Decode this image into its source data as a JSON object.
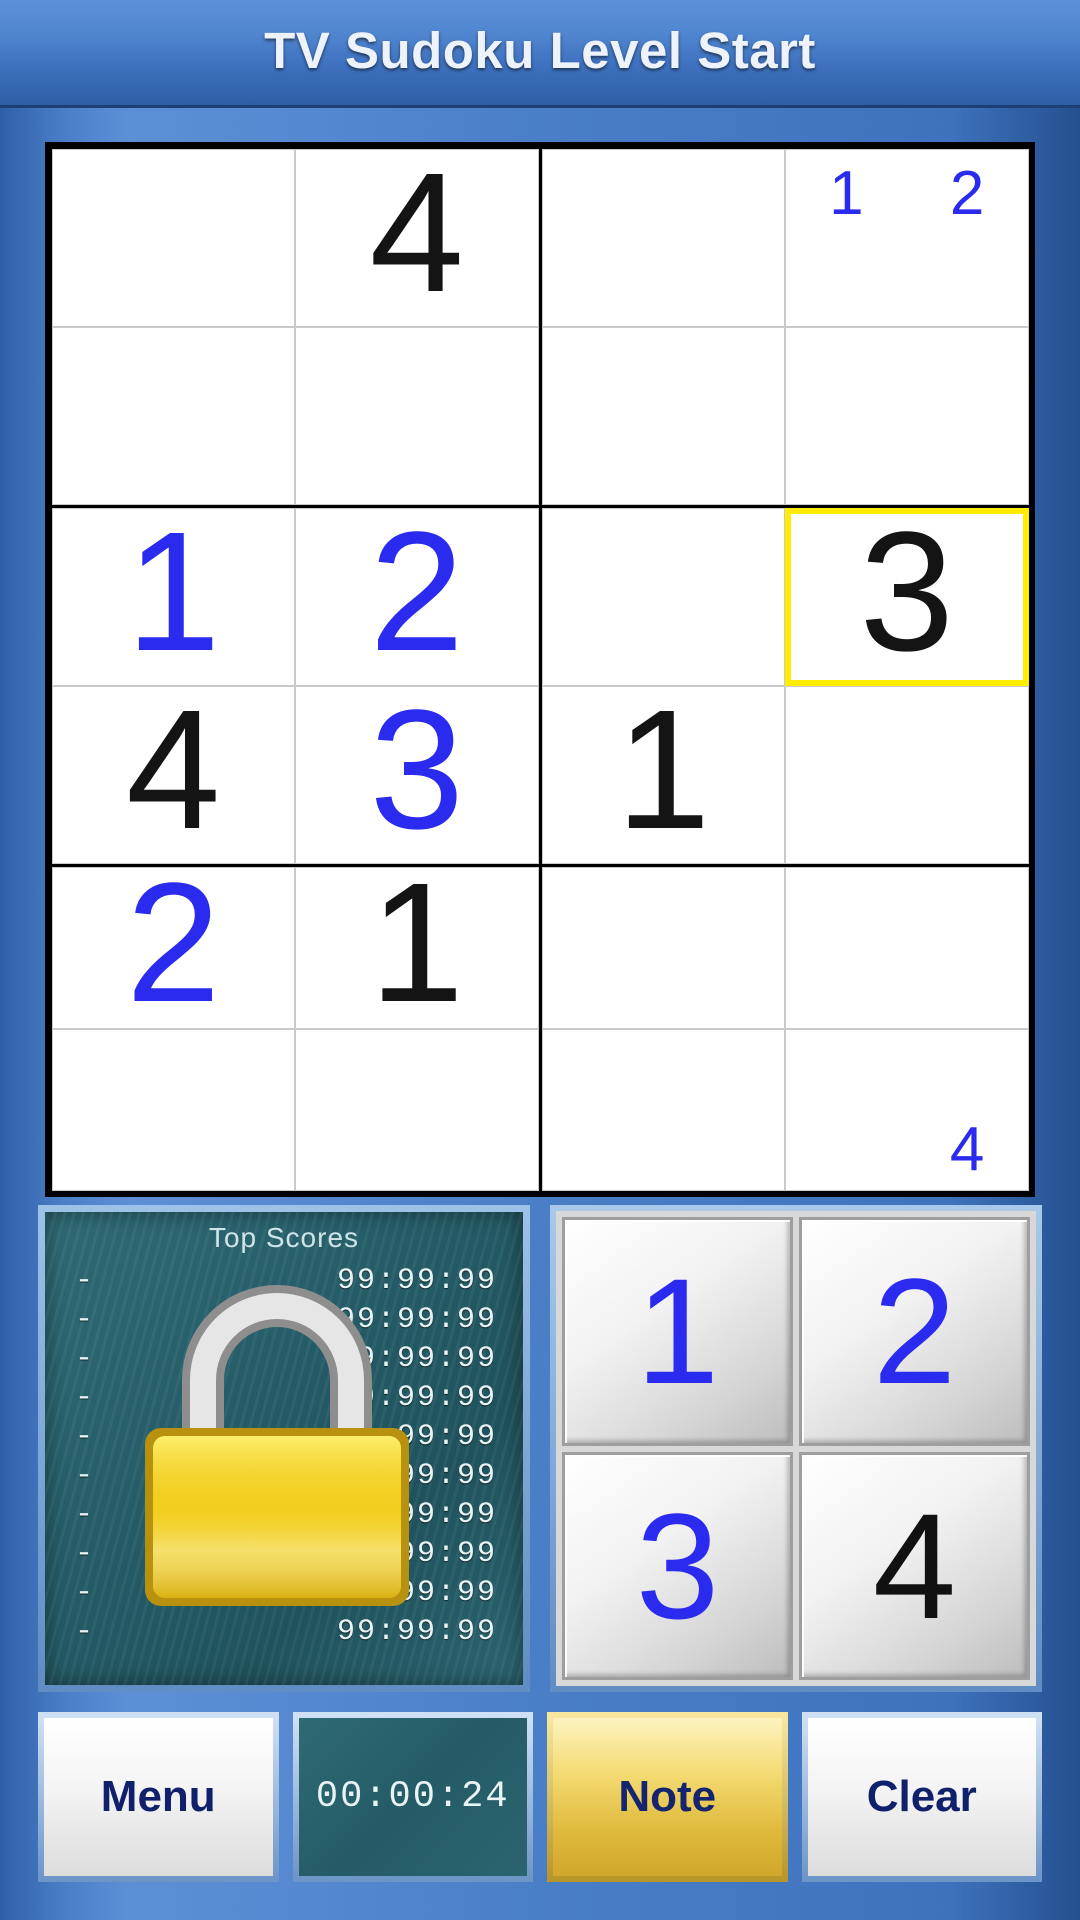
{
  "titlebar": {
    "title": "TV Sudoku Level Start"
  },
  "board": {
    "selected_cell": {
      "block": 3,
      "cell": 1
    },
    "blocks": [
      {
        "cells": [
          {
            "value": "",
            "style": "",
            "notes": []
          },
          {
            "value": "4",
            "style": "given",
            "notes": []
          },
          {
            "value": "",
            "style": "",
            "notes": []
          },
          {
            "value": "",
            "style": "",
            "notes": []
          }
        ]
      },
      {
        "cells": [
          {
            "value": "",
            "style": "",
            "notes": []
          },
          {
            "value": "",
            "style": "",
            "notes": [
              "1",
              "2",
              "",
              ""
            ]
          },
          {
            "value": "",
            "style": "",
            "notes": []
          },
          {
            "value": "",
            "style": "",
            "notes": []
          }
        ]
      },
      {
        "cells": [
          {
            "value": "1",
            "style": "user",
            "notes": []
          },
          {
            "value": "2",
            "style": "user",
            "notes": []
          },
          {
            "value": "4",
            "style": "given",
            "notes": []
          },
          {
            "value": "3",
            "style": "user",
            "notes": []
          }
        ]
      },
      {
        "cells": [
          {
            "value": "",
            "style": "",
            "notes": []
          },
          {
            "value": "3",
            "style": "given",
            "notes": []
          },
          {
            "value": "1",
            "style": "given",
            "notes": []
          },
          {
            "value": "",
            "style": "",
            "notes": []
          }
        ]
      },
      {
        "cells": [
          {
            "value": "2",
            "style": "user",
            "notes": []
          },
          {
            "value": "1",
            "style": "given",
            "notes": []
          },
          {
            "value": "",
            "style": "",
            "notes": []
          },
          {
            "value": "",
            "style": "",
            "notes": []
          }
        ]
      },
      {
        "cells": [
          {
            "value": "",
            "style": "",
            "notes": []
          },
          {
            "value": "",
            "style": "",
            "notes": []
          },
          {
            "value": "",
            "style": "",
            "notes": []
          },
          {
            "value": "",
            "style": "",
            "notes": [
              "",
              "",
              "",
              "4"
            ]
          }
        ]
      }
    ]
  },
  "scores": {
    "title": "Top Scores",
    "locked": true,
    "lock_icon": "padlock-icon",
    "rows": [
      {
        "rank": "-",
        "value": "99:99:99"
      },
      {
        "rank": "-",
        "value": "99:99:99"
      },
      {
        "rank": "-",
        "value": "99:99:99"
      },
      {
        "rank": "-",
        "value": "99:99:99"
      },
      {
        "rank": "-",
        "value": "99:99:99"
      },
      {
        "rank": "-",
        "value": "99:99:99"
      },
      {
        "rank": "-",
        "value": "99:99:99"
      },
      {
        "rank": "-",
        "value": "99:99:99"
      },
      {
        "rank": "-",
        "value": "99:99:99"
      },
      {
        "rank": "-",
        "value": "99:99:99"
      }
    ]
  },
  "keypad": {
    "keys": [
      {
        "label": "1",
        "style": "blue"
      },
      {
        "label": "2",
        "style": "blue"
      },
      {
        "label": "3",
        "style": "blue"
      },
      {
        "label": "4",
        "style": "black"
      }
    ]
  },
  "bottom": {
    "menu_label": "Menu",
    "timer": "00:00:24",
    "note_label": "Note",
    "clear_label": "Clear"
  },
  "colors": {
    "user_digit": "#2b2bf0",
    "given_digit": "#141414",
    "selection": "#ffec00",
    "chrome": "#4a7fc8",
    "panel_teal": "#27606b",
    "note_gold": "#e0bb3e"
  }
}
